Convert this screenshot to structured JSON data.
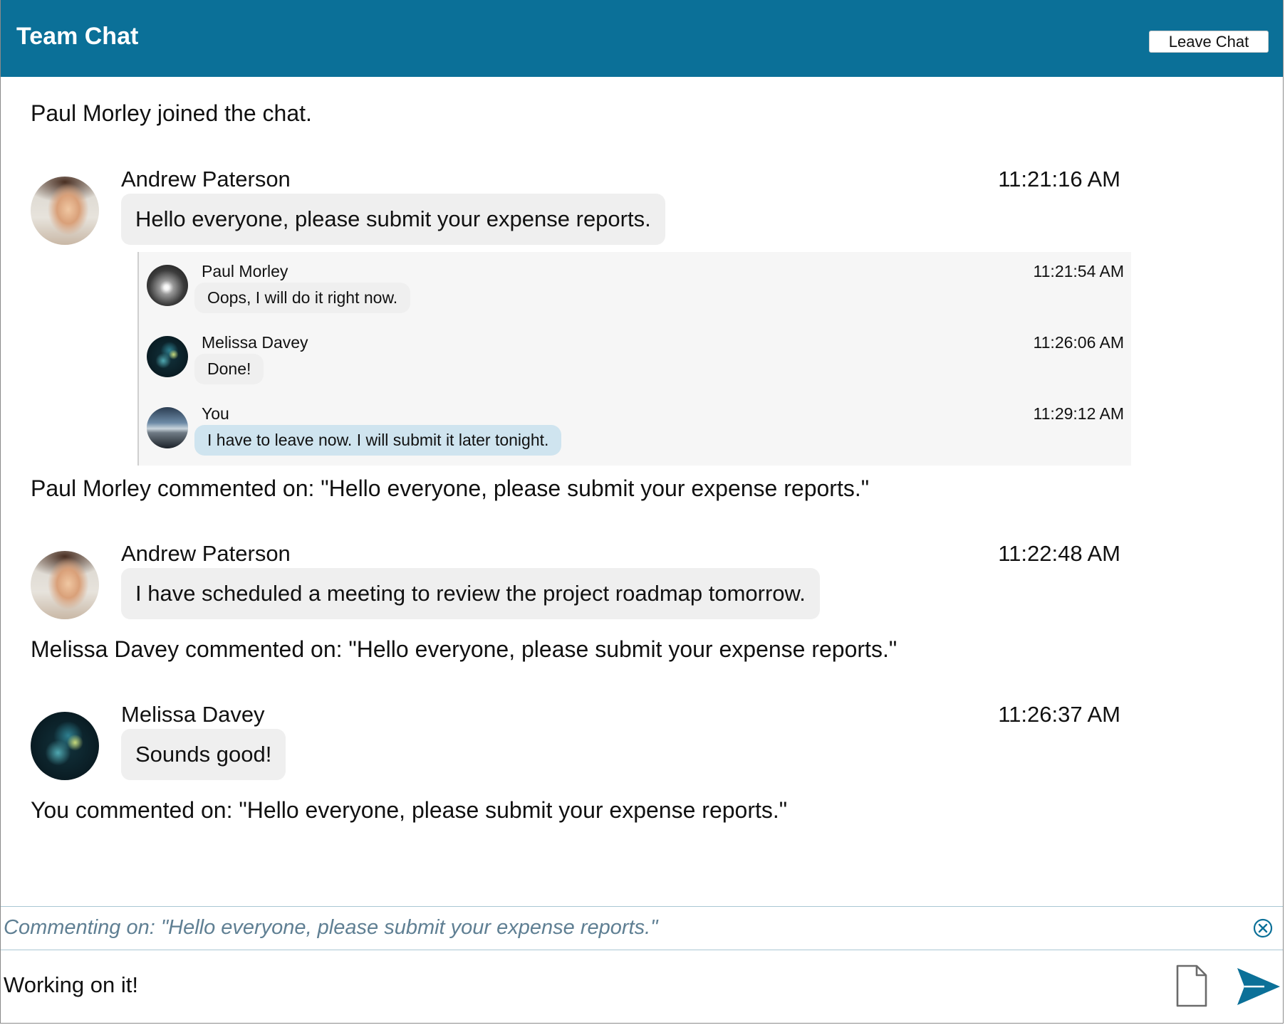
{
  "window": {
    "title": "Team Chat",
    "leave_label": "Leave Chat"
  },
  "colors": {
    "header": "#0b7098",
    "bubble": "#efefef",
    "own_bubble": "#cfe4ef",
    "send": "#0b7098"
  },
  "messages": {
    "event_join": "Paul Morley joined the chat.",
    "m1": {
      "name": "Andrew Paterson",
      "time": "11:21:16 AM",
      "text": "Hello everyone, please submit your expense reports."
    },
    "thread": {
      "r1": {
        "name": "Paul Morley",
        "time": "11:21:54 AM",
        "text": "Oops, I will do it right now."
      },
      "r2": {
        "name": "Melissa Davey",
        "time": "11:26:06 AM",
        "text": "Done!"
      },
      "r3": {
        "name": "You",
        "time": "11:29:12 AM",
        "text": "I have to leave now. I will submit it later tonight."
      }
    },
    "event_comment_paul": "Paul Morley commented on: \"Hello everyone, please submit your expense reports.\"",
    "m2": {
      "name": "Andrew Paterson",
      "time": "11:22:48 AM",
      "text": "I have scheduled a meeting to review the project roadmap tomorrow."
    },
    "event_comment_melissa": "Melissa Davey commented on: \"Hello everyone, please submit your expense reports.\"",
    "m3": {
      "name": "Melissa Davey",
      "time": "11:26:37 AM",
      "text": "Sounds good!"
    },
    "event_comment_you": "You commented on: \"Hello everyone, please submit your expense reports.\""
  },
  "composer": {
    "commenting_on": "Commenting on: \"Hello everyone, please submit your expense reports.\"",
    "input_value": "Working on it!"
  },
  "icons": {
    "close": "close-circle-icon",
    "attach": "document-icon",
    "send": "send-icon"
  }
}
